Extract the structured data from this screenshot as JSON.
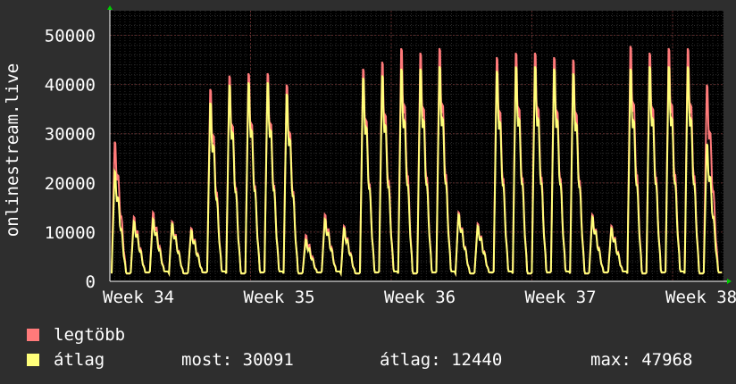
{
  "chart_data": {
    "type": "area",
    "ylabel": "onlinestream.live",
    "ylim": [
      0,
      55000
    ],
    "y_ticks": [
      0,
      10000,
      20000,
      30000,
      40000,
      50000
    ],
    "x_ticks": [
      "Week 34",
      "Week 35",
      "Week 36",
      "Week 37",
      "Week 38"
    ],
    "grid": true,
    "series": [
      {
        "name": "legtöbb",
        "color": "#ff7a7a",
        "daily_peaks": [
          30500,
          14000,
          15000,
          13000,
          11500,
          42000,
          45000,
          45500,
          45500,
          43000,
          10000,
          14500,
          12000,
          46500,
          48000,
          51000,
          50000,
          51000,
          15000,
          12500,
          49000,
          50000,
          50000,
          49000,
          48500,
          14500,
          12000,
          51500,
          50000,
          51000,
          51000,
          43000
        ]
      },
      {
        "name": "átlag",
        "color": "#ffff7a",
        "daily_peaks": [
          24000,
          13000,
          13500,
          12500,
          11000,
          39000,
          43000,
          43500,
          43500,
          41000,
          9000,
          13500,
          11500,
          44500,
          45000,
          46500,
          46500,
          47000,
          14500,
          12000,
          46000,
          47000,
          47000,
          46500,
          45500,
          14000,
          11500,
          46500,
          47000,
          47000,
          47000,
          30000
        ]
      }
    ]
  },
  "legend": {
    "max_label": "legtöbb",
    "avg_label": "átlag",
    "max_color": "#ff7a7a",
    "avg_color": "#ffff7a"
  },
  "stats": {
    "now": "most: 30091",
    "avg": "átlag: 12440",
    "max": "max: 47968"
  }
}
